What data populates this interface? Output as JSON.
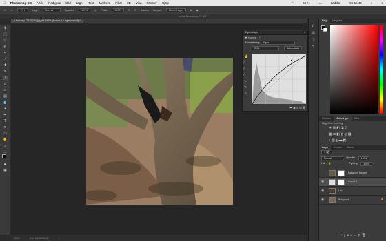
{
  "menubar": {
    "apple": "",
    "app": "Photoshop CC",
    "items": [
      "Arkiv",
      "Redigera",
      "Bild",
      "Lager",
      "Text",
      "Markera",
      "Filter",
      "3D",
      "Visa",
      "Fönster",
      "Hjälp"
    ],
    "status": {
      "wifi": "",
      "battery_pct": "66 %",
      "charging": "Laddar",
      "time": "Sö 15:49"
    }
  },
  "options": {
    "mode_label": "Läge:",
    "mode": "Normal",
    "opacity_label": "Opacitet:",
    "opacity": "100%",
    "flow_label": "Flöde:",
    "flow": "100%",
    "align": "Justera",
    "sample_label": "Sampel:",
    "sample": "Aktuellt lager"
  },
  "window_title": "Adobe Photoshop CC 2017",
  "doc_tab": "Balcony 20131204.jpg vid 100% (Kurvor 1, Lagermask/8) *",
  "status": {
    "zoom": "100%",
    "doc": "Dok: 5,40M/10,9M"
  },
  "properties": {
    "title": "Egenskaper",
    "panel": "Kurvor",
    "preset_label": "Förinställning:",
    "preset": "Egen",
    "channel": "RGB",
    "auto": "Automatiskt"
  },
  "color_panel": {
    "tabs": [
      "Färg",
      "Färgrutor"
    ]
  },
  "adjustments": {
    "tabs": [
      "Bibliotek",
      "Justeringar",
      "Stilar"
    ],
    "hint": "Lägg till en justering"
  },
  "layers": {
    "tabs": [
      "Lager",
      "Kanaler",
      "Banor"
    ],
    "kind": "Typ",
    "blend": "Normal",
    "opacity_label": "Opacitet:",
    "opacity": "100%",
    "lock_label": "Lås:",
    "fill_label": "Fyllning:",
    "fill": "100%",
    "items": [
      {
        "name": "Bakgrund kopiera"
      },
      {
        "name": "Kurvor 1"
      },
      {
        "name": "Lila"
      },
      {
        "name": "Bakgrund"
      }
    ]
  },
  "colors": {
    "accent": "#e8312f",
    "panel": "#3b3b3b"
  }
}
